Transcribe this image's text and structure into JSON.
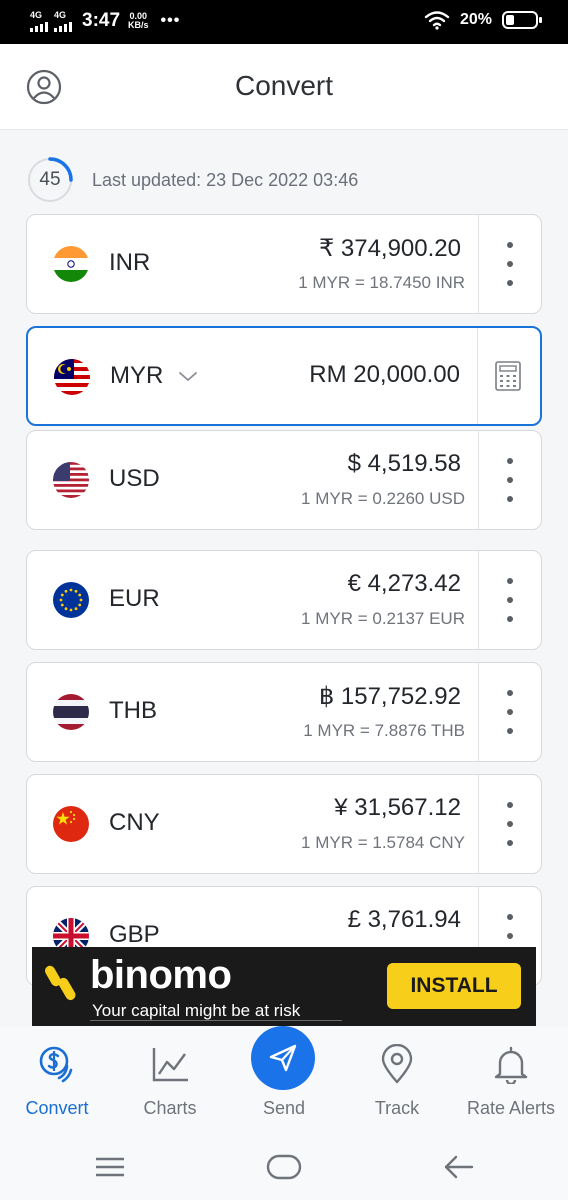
{
  "status_bar": {
    "net1": "4G",
    "net2": "4G",
    "time": "3:47",
    "speed_value": "0.00",
    "speed_unit": "KB/s",
    "more": "•••",
    "battery_pct": "20%",
    "battery_level": 0.2
  },
  "header": {
    "title": "Convert",
    "profile_icon": "user-circle-icon"
  },
  "update": {
    "seconds": "45",
    "last_updated": "Last updated: 23 Dec 2022 03:46"
  },
  "currencies": [
    {
      "code": "INR",
      "amount": "₹ 374,900.20",
      "rate": "1 MYR = 18.7450 INR",
      "flag": "india-flag-icon"
    },
    {
      "code": "MYR",
      "amount": "RM 20,000.00",
      "rate": "",
      "flag": "malaysia-flag-icon",
      "selected": true
    },
    {
      "code": "USD",
      "amount": "$ 4,519.58",
      "rate": "1 MYR = 0.2260 USD",
      "flag": "usa-flag-icon"
    },
    {
      "code": "EUR",
      "amount": "€ 4,273.42",
      "rate": "1 MYR = 0.2137 EUR",
      "flag": "eu-flag-icon"
    },
    {
      "code": "THB",
      "amount": "฿ 157,752.92",
      "rate": "1 MYR = 7.8876 THB",
      "flag": "thailand-flag-icon"
    },
    {
      "code": "CNY",
      "amount": "¥ 31,567.12",
      "rate": "1 MYR = 1.5784 CNY",
      "flag": "china-flag-icon"
    },
    {
      "code": "GBP",
      "amount": "£ 3,761.94",
      "rate": "",
      "flag": "uk-flag-icon"
    }
  ],
  "ad": {
    "brand": "binomo",
    "tagline": "Your capital might be at risk",
    "install_label": "INSTALL",
    "install_color": "#f7cf1b"
  },
  "bottom_nav": [
    {
      "label": "Convert",
      "icon": "dollar-exchange-icon",
      "active": true
    },
    {
      "label": "Charts",
      "icon": "line-chart-icon"
    },
    {
      "label": "Send",
      "icon": "paper-plane-icon"
    },
    {
      "label": "Track",
      "icon": "location-pin-icon"
    },
    {
      "label": "Rate Alerts",
      "icon": "bell-icon"
    }
  ],
  "colors": {
    "accent": "#1a73e8",
    "selected_border": "#1a73d9"
  }
}
